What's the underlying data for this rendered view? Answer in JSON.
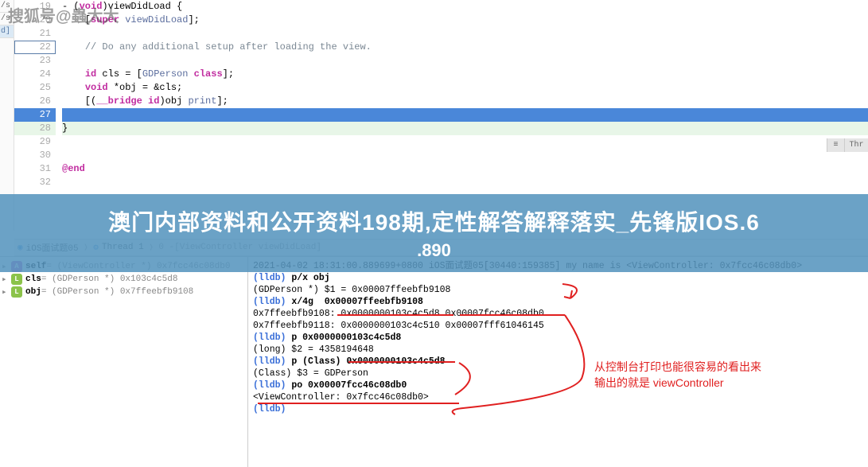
{
  "watermark": "搜狐号@蟲大大",
  "left_tabs": [
    "/s",
    "/s",
    "d]"
  ],
  "code": {
    "lines": [
      {
        "num": "19",
        "parts": [
          {
            "t": "- (",
            "c": ""
          },
          {
            "t": "void",
            "c": "kw"
          },
          {
            "t": ")viewDidLoad {",
            "c": ""
          }
        ]
      },
      {
        "num": "20",
        "parts": [
          {
            "t": "    [",
            "c": ""
          },
          {
            "t": "super",
            "c": "kw"
          },
          {
            "t": " ",
            "c": ""
          },
          {
            "t": "viewDidLoad",
            "c": "cls"
          },
          {
            "t": "];",
            "c": ""
          }
        ]
      },
      {
        "num": "21",
        "parts": []
      },
      {
        "num": "22",
        "parts": [
          {
            "t": "    ",
            "c": ""
          },
          {
            "t": "// Do any additional setup after loading the view.",
            "c": "cmt"
          }
        ],
        "box": true
      },
      {
        "num": "23",
        "parts": []
      },
      {
        "num": "24",
        "parts": [
          {
            "t": "    ",
            "c": ""
          },
          {
            "t": "id",
            "c": "kw"
          },
          {
            "t": " cls = [",
            "c": ""
          },
          {
            "t": "GDPerson",
            "c": "cls"
          },
          {
            "t": " ",
            "c": ""
          },
          {
            "t": "class",
            "c": "kw"
          },
          {
            "t": "];",
            "c": ""
          }
        ]
      },
      {
        "num": "25",
        "parts": [
          {
            "t": "    ",
            "c": ""
          },
          {
            "t": "void",
            "c": "kw"
          },
          {
            "t": " *obj = &cls;",
            "c": ""
          }
        ]
      },
      {
        "num": "26",
        "parts": [
          {
            "t": "    [(",
            "c": ""
          },
          {
            "t": "__bridge",
            "c": "kw"
          },
          {
            "t": " ",
            "c": ""
          },
          {
            "t": "id",
            "c": "kw"
          },
          {
            "t": ")obj ",
            "c": ""
          },
          {
            "t": "print",
            "c": "cls"
          },
          {
            "t": "];",
            "c": ""
          }
        ]
      },
      {
        "num": "27",
        "parts": [],
        "current": true
      },
      {
        "num": "28",
        "parts": [
          {
            "t": "}",
            "c": ""
          }
        ],
        "modified": true
      },
      {
        "num": "29",
        "parts": []
      },
      {
        "num": "30",
        "parts": []
      },
      {
        "num": "31",
        "parts": [
          {
            "t": "@end",
            "c": "kw"
          }
        ]
      },
      {
        "num": "32",
        "parts": []
      }
    ]
  },
  "banner": {
    "title": "澳门内部资料和公开资料198期,定性解答解释落实_先锋版IOS.6",
    "sub": ".890"
  },
  "breadcrumb": {
    "items": [
      "iOS面试题05",
      "Thread 1",
      "0 -[ViewController viewDidLoad]"
    ],
    "thread_icon": "⚙"
  },
  "vars": [
    {
      "icon": "A",
      "name": "self",
      "val": " = (ViewController *) 0x7fcc46c08db0"
    },
    {
      "icon": "L",
      "name": "cls",
      "val": " = (GDPerson *) 0x103c4c5d8"
    },
    {
      "icon": "L",
      "name": "obj",
      "val": " = (GDPerson *) 0x7ffeebfb9108"
    }
  ],
  "console": {
    "lines": [
      {
        "pre": "",
        "t": "2021-04-02 18:31:00.889699+0800 iOS面试题05[30440:159385] my name is <ViewController: 0x7fcc46c08db0>"
      },
      {
        "pre": "(lldb) ",
        "t": "p/x obj"
      },
      {
        "pre": "",
        "t": "(GDPerson *) $1 = 0x00007ffeebfb9108"
      },
      {
        "pre": "(lldb) ",
        "t": "x/4g  0x00007ffeebfb9108"
      },
      {
        "pre": "",
        "t": "0x7ffeebfb9108: 0x0000000103c4c5d8 0x00007fcc46c08db0"
      },
      {
        "pre": "",
        "t": "0x7ffeebfb9118: 0x0000000103c4c510 0x00007fff61046145"
      },
      {
        "pre": "(lldb) ",
        "t": "p 0x0000000103c4c5d8"
      },
      {
        "pre": "",
        "t": "(long) $2 = 4358194648"
      },
      {
        "pre": "(lldb) ",
        "t": "p (Class) 0x0000000103c4c5d8"
      },
      {
        "pre": "",
        "t": "(Class) $3 = GDPerson"
      },
      {
        "pre": "(lldb) ",
        "t": "po 0x00007fcc46c08db0"
      },
      {
        "pre": "",
        "t": "<ViewController: 0x7fcc46c08db0>"
      },
      {
        "pre": "",
        "t": ""
      },
      {
        "pre": "(lldb) ",
        "t": ""
      }
    ]
  },
  "annotation": {
    "line1": "从控制台打印也能很容易的看出来",
    "line2": "输出的就是 viewController"
  },
  "right_buttons": [
    "≡",
    "Thr"
  ]
}
